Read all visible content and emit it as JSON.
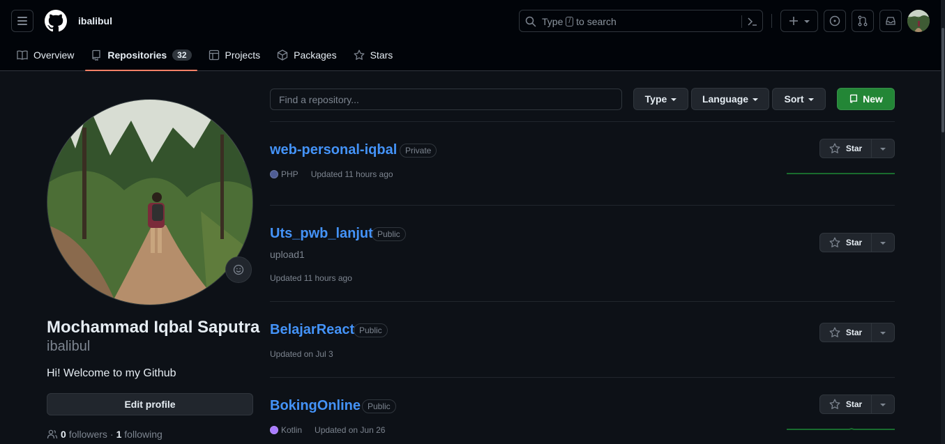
{
  "header": {
    "username": "ibalibul",
    "search": {
      "prefix": "Type",
      "key": "/",
      "suffix": "to search"
    }
  },
  "tabs": [
    {
      "label": "Overview",
      "icon": "book-icon"
    },
    {
      "label": "Repositories",
      "icon": "repo-icon",
      "count": "32",
      "active": true
    },
    {
      "label": "Projects",
      "icon": "table-icon"
    },
    {
      "label": "Packages",
      "icon": "package-icon"
    },
    {
      "label": "Stars",
      "icon": "star-icon"
    }
  ],
  "profile": {
    "full_name": "Mochammad Iqbal Saputra",
    "handle": "ibalibul",
    "bio": "Hi! Welcome to my Github",
    "edit_label": "Edit profile",
    "followers_count": "0",
    "followers_label": "followers",
    "separator": "·",
    "following_count": "1",
    "following_label": "following"
  },
  "filters": {
    "search_placeholder": "Find a repository...",
    "type_label": "Type",
    "language_label": "Language",
    "sort_label": "Sort",
    "new_label": "New"
  },
  "repos": [
    {
      "name": "web-personal-iqbal",
      "visibility": "Private",
      "description": "",
      "language": "PHP",
      "language_color": "#4F5D95",
      "updated": "Updated 11 hours ago",
      "star_label": "Star"
    },
    {
      "name": "Uts_pwb_lanjut",
      "visibility": "Public",
      "description": "upload1",
      "language": "",
      "updated": "Updated 11 hours ago",
      "star_label": "Star"
    },
    {
      "name": "BelajarReact",
      "visibility": "Public",
      "description": "",
      "language": "",
      "updated": "Updated on Jul 3",
      "star_label": "Star"
    },
    {
      "name": "BokingOnline",
      "visibility": "Public",
      "description": "",
      "language": "Kotlin",
      "language_color": "#A97BFF",
      "updated": "Updated on Jun 26",
      "star_label": "Star"
    }
  ],
  "colors": {
    "accent": "#f78166",
    "link": "#4493f8",
    "primary_button": "#238636",
    "background": "#0d1117"
  }
}
